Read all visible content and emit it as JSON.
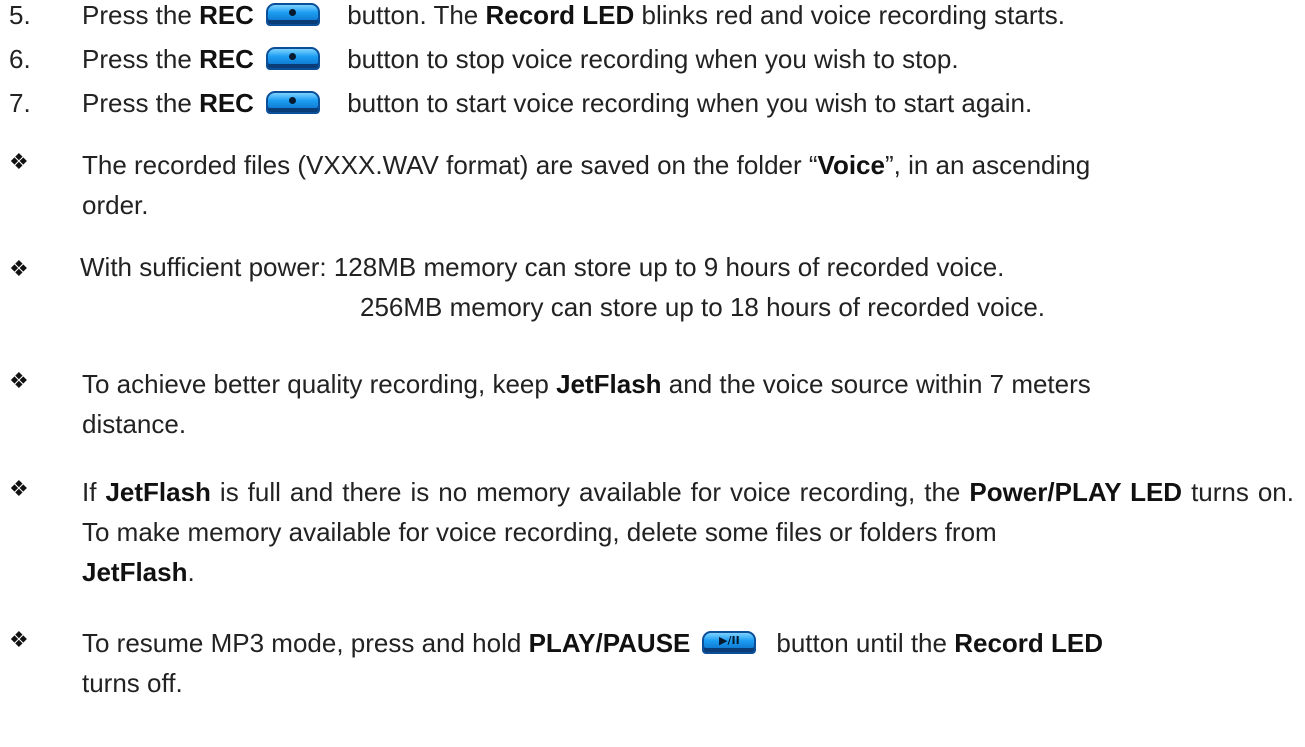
{
  "steps": [
    {
      "num": "5.",
      "pre": "Press the ",
      "btn": "REC",
      "mid": " button. The ",
      "b2": "Record LED",
      "post": " blinks red and voice recording starts."
    },
    {
      "num": "6.",
      "pre": "Press the ",
      "btn": "REC",
      "post": " button to stop voice recording when you wish to stop."
    },
    {
      "num": "7.",
      "pre": "Press the ",
      "btn": "REC",
      "post": " button to start voice recording when you wish to start again."
    }
  ],
  "bullet_glyph": "❖",
  "notes": {
    "saved": {
      "a": "The recorded files (VXXX.WAV format) are saved on the folder “",
      "b": "Voice",
      "c": "”, in an ascending",
      "d": "order."
    },
    "power": {
      "line1": "With sufficient power: 128MB memory can store up to 9 hours of recorded voice.",
      "line2": "256MB memory can store up to 18 hours of recorded voice."
    },
    "quality": {
      "a": "To achieve better quality recording, keep ",
      "b": "JetFlash",
      "c": " and the voice source within 7 meters",
      "d": "distance."
    },
    "full": {
      "a": "If ",
      "b": "JetFlash",
      "c": " is full and there is no memory available for voice recording, the ",
      "d": "Power/PLAY LED",
      "e": "turns on. To make memory available for voice recording, delete some files or folders from",
      "f": "JetFlash",
      "g": "."
    },
    "resume": {
      "a": "To resume MP3 mode, press and hold ",
      "b": "PLAY/PAUSE",
      "c": "button until the ",
      "d": "Record LED",
      "e": "turns off."
    }
  },
  "icons": {
    "rec_button": "rec-button-icon",
    "play_pause_button": "play-pause-button-icon",
    "play_pause_glyph": "▶/II"
  },
  "colors": {
    "button_blue": "#1c9df2",
    "button_border": "#0b4f98"
  }
}
